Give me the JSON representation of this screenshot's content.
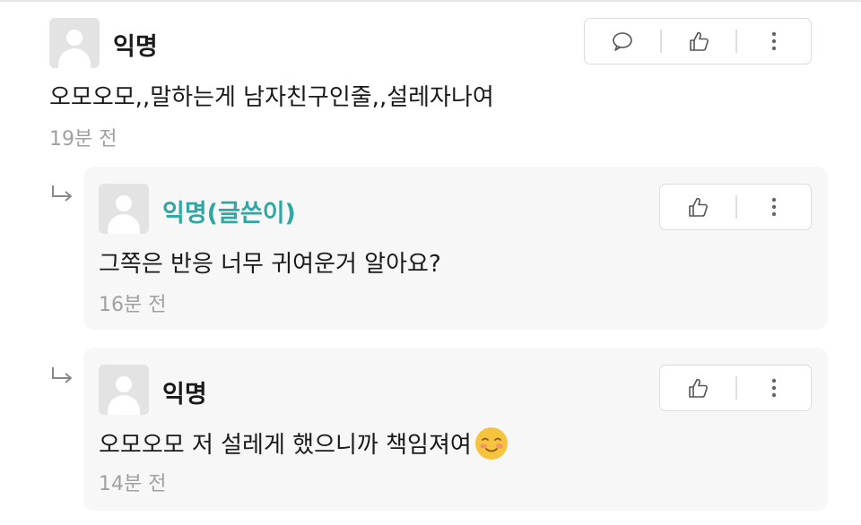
{
  "comments": [
    {
      "author": "익명",
      "text": "오모오모,,말하는게 남자친구인줄,,설레자나여",
      "time": "19분 전"
    }
  ],
  "replies": [
    {
      "author": "익명(글쓴이)",
      "text": "그쪽은 반응 너무 귀여운거 알아요?",
      "time": "16분 전"
    },
    {
      "author": "익명",
      "text": "오모오모 저 설레게 했으니까 책임져여",
      "emoji": "smiling-face-emoji",
      "time": "14분 전"
    }
  ],
  "colors": {
    "author_name": "#2fa8a3",
    "timestamp": "#a0a0a0",
    "reply_background": "#f7f7f7"
  }
}
